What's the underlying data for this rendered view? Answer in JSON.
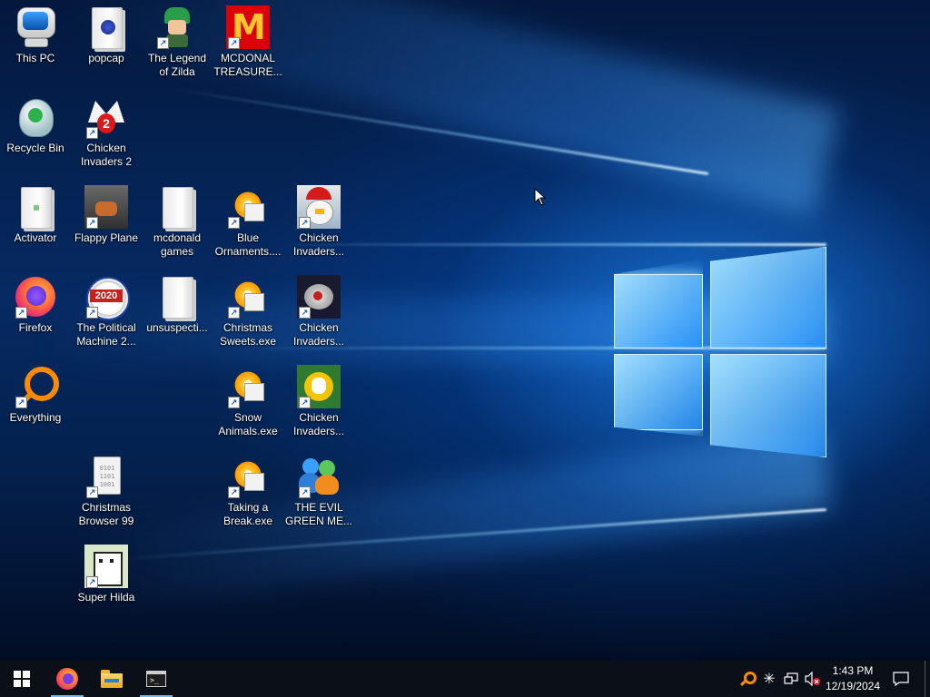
{
  "desktop": {
    "icons": [
      {
        "id": "this-pc",
        "label": "This PC",
        "icon": "computer-icon"
      },
      {
        "id": "popcap",
        "label": "popcap",
        "icon": "folder-icon"
      },
      {
        "id": "legend-of-zilda",
        "label": "The Legend\nof Zilda",
        "icon": "elf-character-icon"
      },
      {
        "id": "mcdonal-treasure",
        "label": "MCDONAL\nTREASURE...",
        "icon": "golden-arches-icon"
      },
      {
        "id": "recycle-bin",
        "label": "Recycle Bin",
        "icon": "recycle-bin-icon"
      },
      {
        "id": "chicken-invaders-2",
        "label": "Chicken\nInvaders 2",
        "icon": "chicken-icon"
      },
      {
        "id": "activator",
        "label": "Activator",
        "icon": "folder-icon"
      },
      {
        "id": "flappy-plane",
        "label": "Flappy Plane",
        "icon": "plane-icon"
      },
      {
        "id": "mcdonald-games",
        "label": "mcdonald\ngames",
        "icon": "folder-icon"
      },
      {
        "id": "blue-ornaments",
        "label": "Blue\nOrnaments....",
        "icon": "sunburst-installer-icon"
      },
      {
        "id": "chicken-invaders-a",
        "label": "Chicken\nInvaders...",
        "icon": "santa-chicken-icon"
      },
      {
        "id": "firefox",
        "label": "Firefox",
        "icon": "firefox-icon"
      },
      {
        "id": "political-machine",
        "label": "The Political\nMachine 2...",
        "icon": "badge-2020-icon"
      },
      {
        "id": "unsuspecti",
        "label": "unsuspecti...",
        "icon": "folder-icon"
      },
      {
        "id": "christmas-sweets",
        "label": "Christmas\nSweets.exe",
        "icon": "sunburst-installer-icon"
      },
      {
        "id": "chicken-invaders-b",
        "label": "Chicken\nInvaders...",
        "icon": "spaceship-chicken-icon"
      },
      {
        "id": "everything",
        "label": "Everything",
        "icon": "magnifier-icon"
      },
      {
        "id": "snow-animals",
        "label": "Snow\nAnimals.exe",
        "icon": "sunburst-installer-icon"
      },
      {
        "id": "chicken-invaders-c",
        "label": "Chicken\nInvaders...",
        "icon": "chicken-5-icon"
      },
      {
        "id": "christmas-browser",
        "label": "Christmas\nBrowser 99",
        "icon": "binary-file-icon"
      },
      {
        "id": "taking-a-break",
        "label": "Taking a\nBreak.exe",
        "icon": "sunburst-installer-icon"
      },
      {
        "id": "evil-green-me",
        "label": "THE EVIL\nGREEN ME...",
        "icon": "messenger-people-icon"
      },
      {
        "id": "super-hilda",
        "label": "Super Hilda",
        "icon": "pixel-dog-icon"
      }
    ]
  },
  "taskbar": {
    "start_icon": "windows-start-icon",
    "pinned": [
      {
        "id": "firefox",
        "icon": "firefox-icon",
        "active": true
      },
      {
        "id": "file-explorer",
        "icon": "folder-icon",
        "active": false
      },
      {
        "id": "terminal",
        "icon": "terminal-icon",
        "active": true
      }
    ],
    "tray_icons": [
      "everything-tray-icon",
      "network-star-icon",
      "network-icon",
      "volume-muted-icon"
    ],
    "clock": {
      "time": "1:43 PM",
      "date": "12/19/2024"
    },
    "notification_icon": "action-center-icon"
  },
  "colors": {
    "accent": "#76b9ed",
    "taskbar": "#0b0f17",
    "desktop": "#062a63"
  }
}
